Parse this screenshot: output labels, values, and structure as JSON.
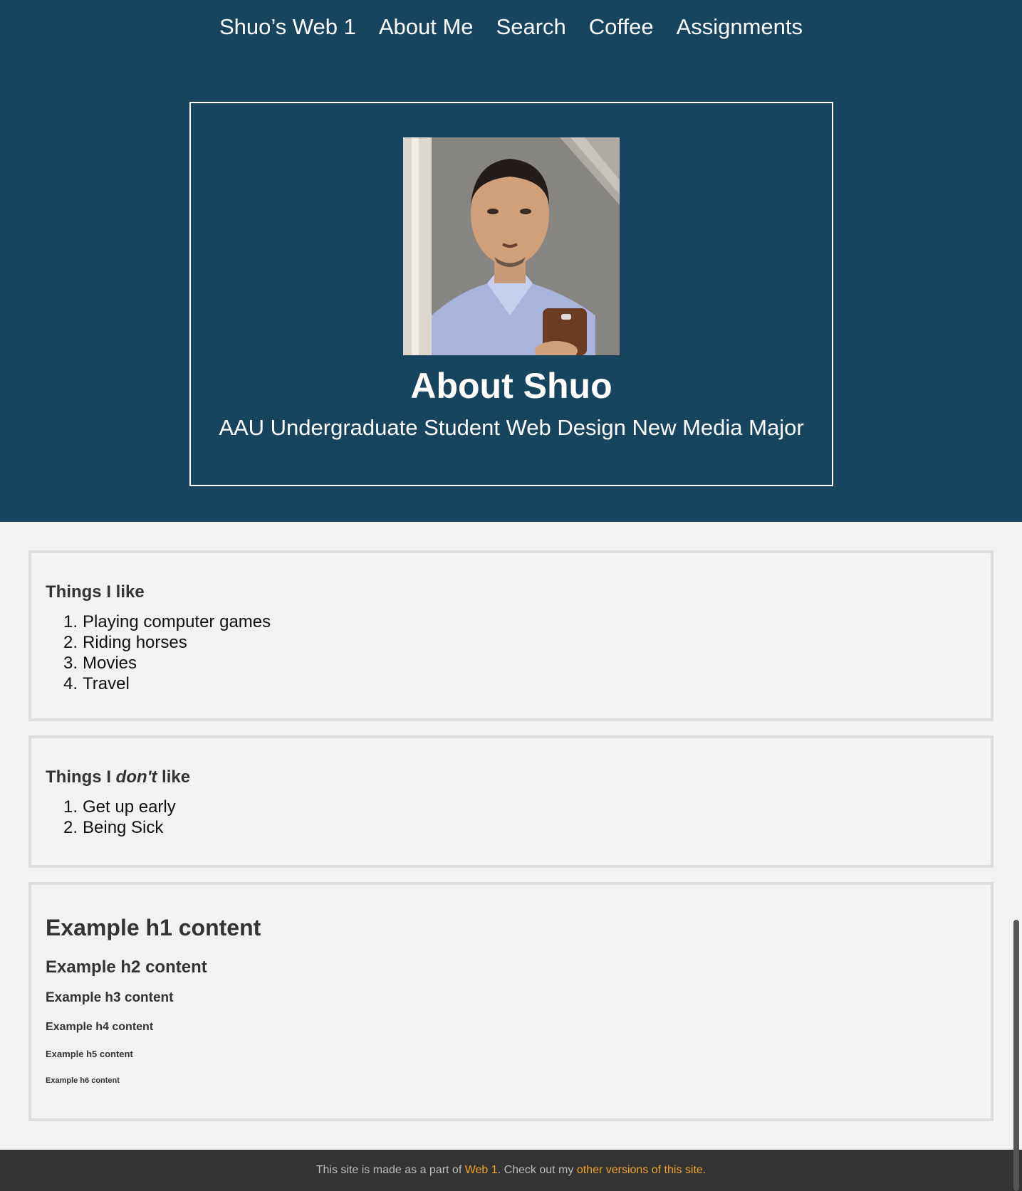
{
  "nav": {
    "items": [
      "Shuo’s Web 1",
      "About Me",
      "Search",
      "Coffee",
      "Assignments"
    ]
  },
  "hero": {
    "title": "About Shuo",
    "subtitle": "AAU Undergraduate Student Web Design New Media Major"
  },
  "likes": {
    "heading": "Things I like",
    "items": [
      "Playing computer games",
      "Riding horses",
      "Movies",
      "Travel"
    ]
  },
  "dislikes": {
    "heading_pre": "Things I ",
    "heading_em": "don't",
    "heading_post": " like",
    "items": [
      "Get up early",
      "Being Sick"
    ]
  },
  "examples": {
    "h1": "Example h1 content",
    "h2": "Example h2 content",
    "h3": "Example h3 content",
    "h4": "Example h4 content",
    "h5": "Example h5 content",
    "h6": "Example h6 content"
  },
  "footer": {
    "text1": "This site is made as a part of ",
    "link1": "Web 1",
    "text2": ". Check out my ",
    "link2": "other versions of this site."
  },
  "colors": {
    "header_bg": "#174560",
    "page_bg": "#f2f2f2",
    "footer_bg": "#333333",
    "link": "#f0a22c"
  }
}
